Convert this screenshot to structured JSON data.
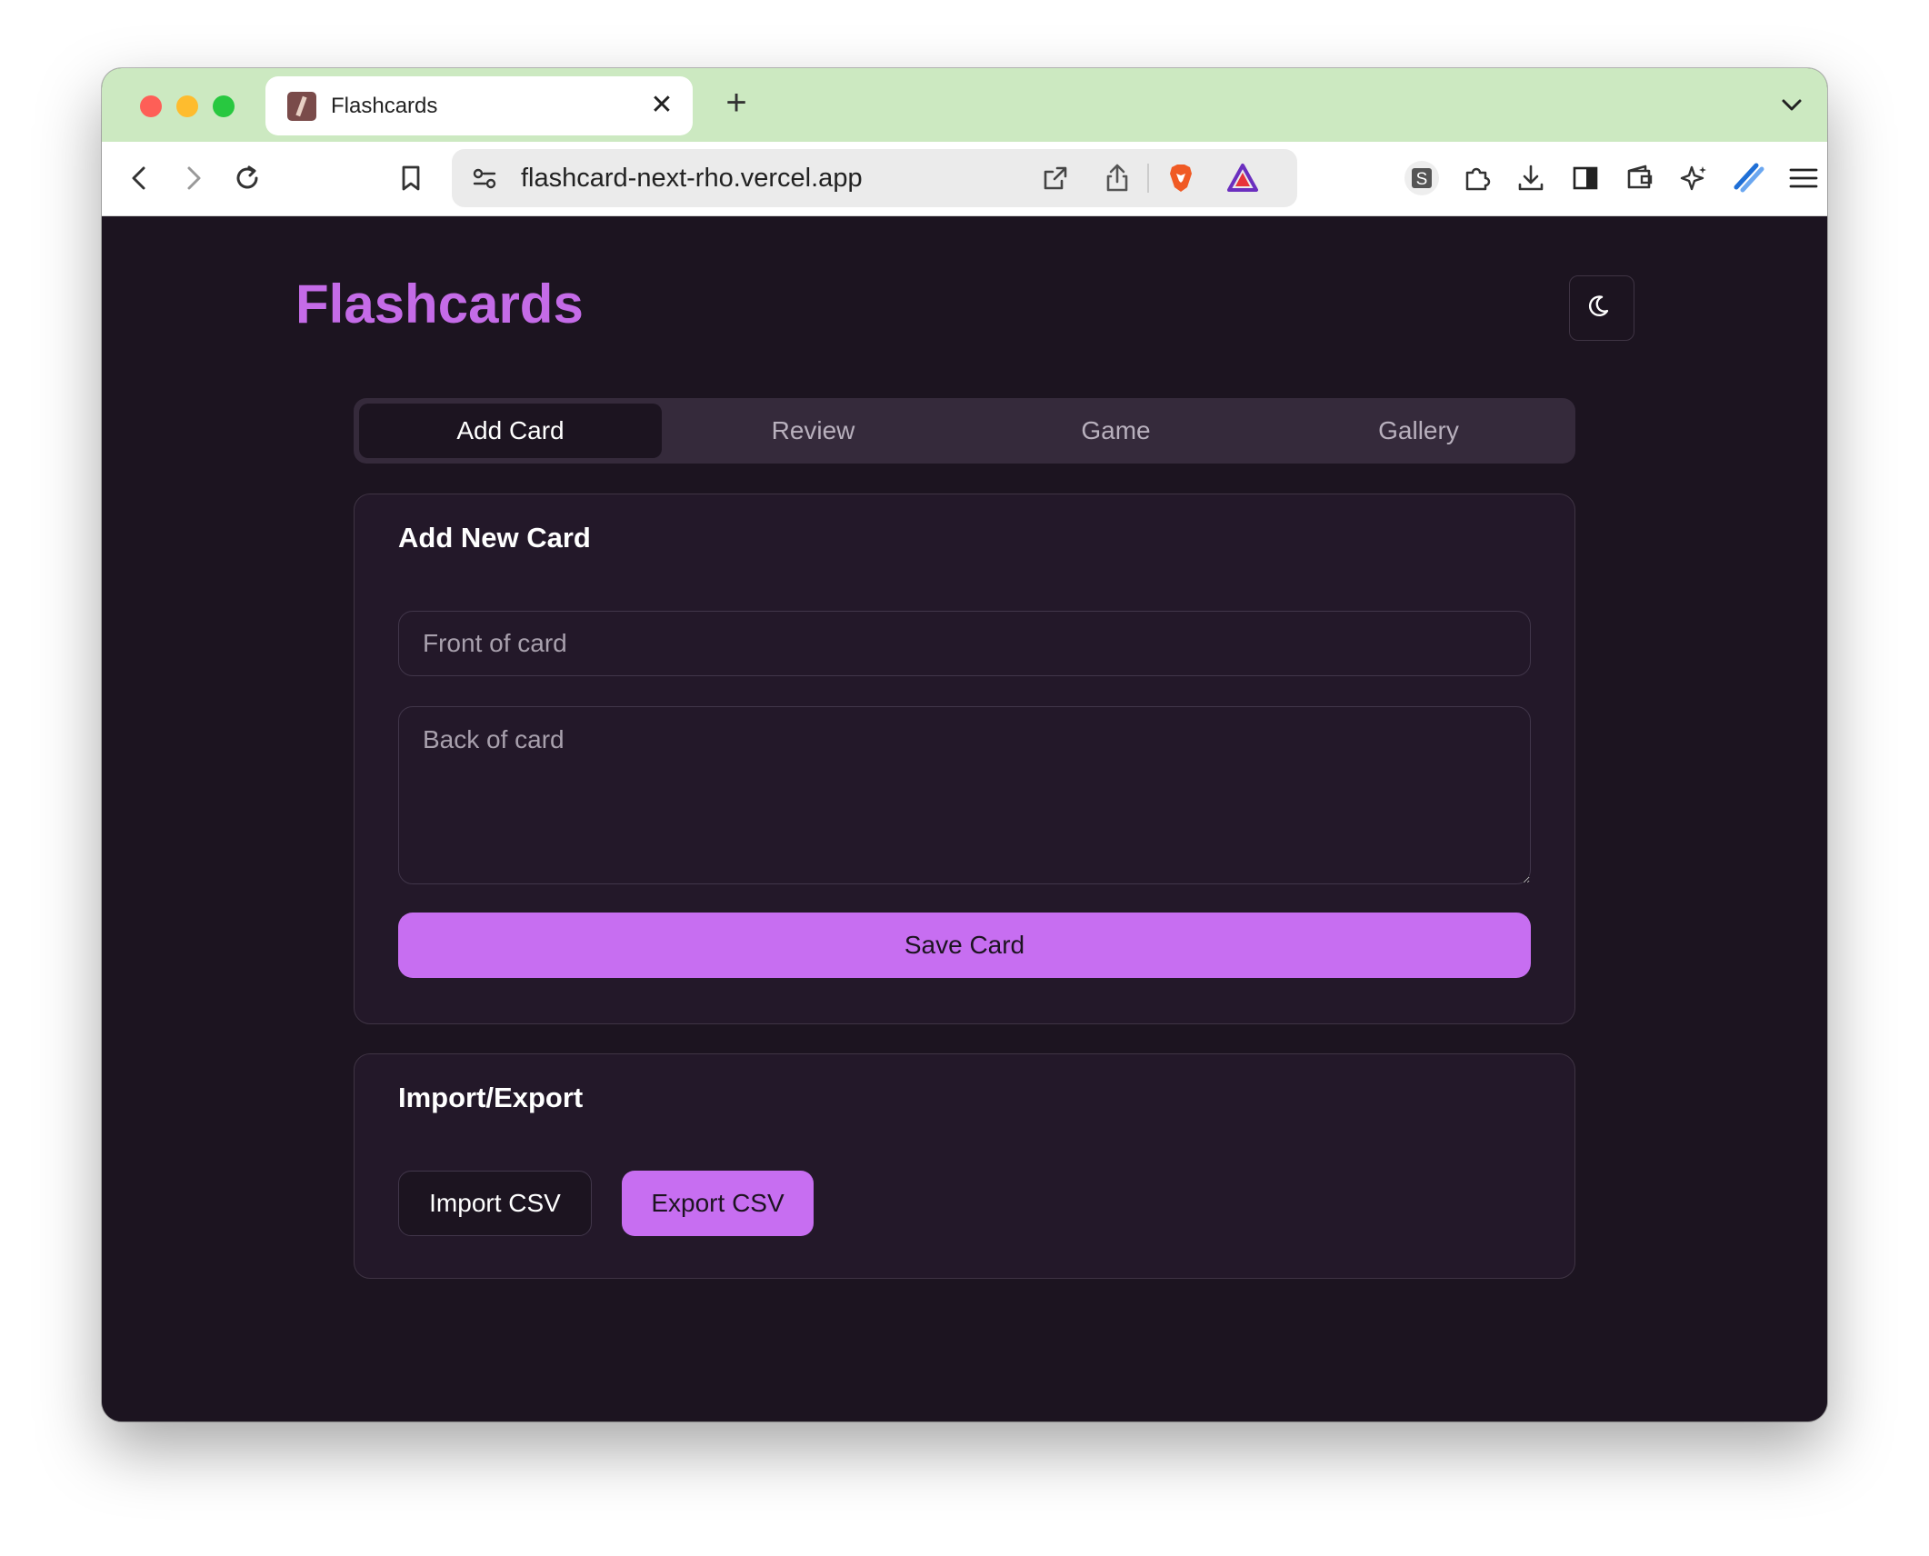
{
  "browser": {
    "tab_title": "Flashcards",
    "tab_close": "✕",
    "new_tab": "+",
    "url": "flashcard-next-rho.vercel.app",
    "colors": {
      "tabstrip": "#cce9c1",
      "toolbar": "#ffffff"
    }
  },
  "app": {
    "title": "Flashcards",
    "theme_icon": "moon-icon",
    "accent": "#c76ef1",
    "background": "#1c1420"
  },
  "tabs": [
    {
      "label": "Add Card",
      "active": true
    },
    {
      "label": "Review",
      "active": false
    },
    {
      "label": "Game",
      "active": false
    },
    {
      "label": "Gallery",
      "active": false
    }
  ],
  "add_card": {
    "heading": "Add New Card",
    "front_placeholder": "Front of card",
    "back_placeholder": "Back of card",
    "save_label": "Save Card"
  },
  "import_export": {
    "heading": "Import/Export",
    "import_label": "Import CSV",
    "export_label": "Export CSV"
  }
}
